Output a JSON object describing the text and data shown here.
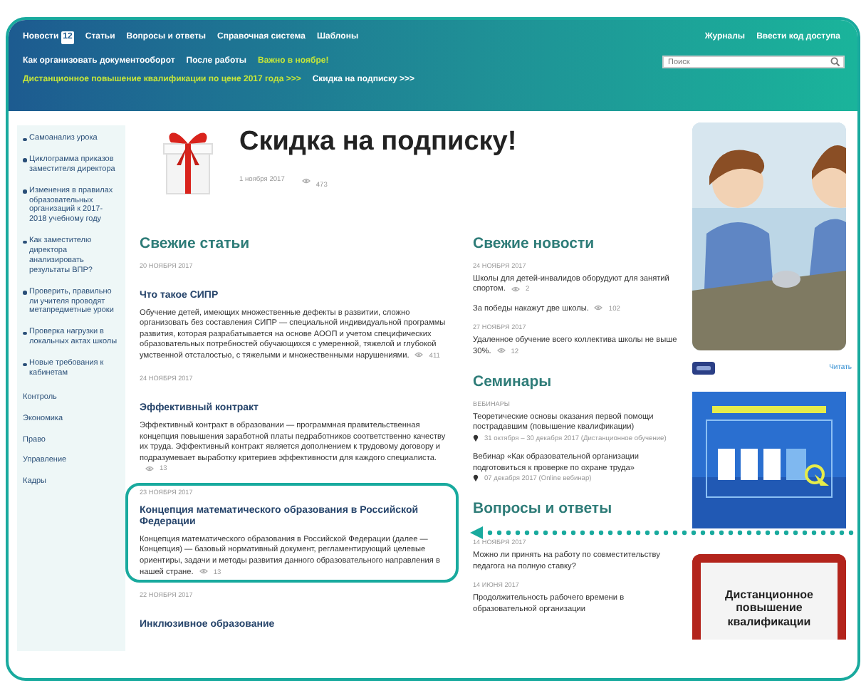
{
  "header": {
    "nav_primary": [
      {
        "label": "Новости",
        "badge": "12"
      },
      {
        "label": "Статьи"
      },
      {
        "label": "Вопросы и ответы"
      },
      {
        "label": "Справочная система"
      },
      {
        "label": "Шаблоны"
      }
    ],
    "nav_right": [
      "Журналы",
      "Ввести код доступа"
    ],
    "nav_secondary": [
      {
        "label": "Как организовать документооборот",
        "highlight": false
      },
      {
        "label": "После работы",
        "highlight": false
      },
      {
        "label": "Важно в ноябре!",
        "highlight": true
      }
    ],
    "search": {
      "placeholder": "Поиск"
    },
    "promos": [
      {
        "label": "Дистанционное повышение квалификации по цене 2017 года >>>",
        "highlight": true
      },
      {
        "label": "Скидка на подписку >>>",
        "highlight": false
      }
    ]
  },
  "sidebar": {
    "articles": [
      "Самоанализ урока",
      "Циклограмма приказов заместителя директора",
      "Изменения в правилах образовательных организаций к 2017-2018 учебному году",
      "Как заместителю директора анализировать результаты ВПР?",
      "Проверить, правильно ли учителя проводят метапредметные уроки",
      "Проверка нагрузки в локальных актах школы",
      "Новые требования к кабинетам"
    ],
    "categories": [
      "Контроль",
      "Экономика",
      "Право",
      "Управление",
      "Кадры"
    ]
  },
  "promo": {
    "title": "Скидка на подписку!",
    "date": "1 ноября 2017",
    "views": "473"
  },
  "articles": {
    "heading": "Свежие статьи",
    "items": [
      {
        "date": "20 НОЯБРЯ 2017",
        "title": "Что такое СИПР",
        "summary": "Обучение детей, имеющих множественные дефекты в развитии, сложно организовать без составления СИПР — специальной индивидуальной программы развития, которая разрабатывается на основе АООП и учетом специфических образовательных потребностей обучающихся с умеренной, тяжелой и глубокой умственной отсталостью, с тяжелыми и множественными нарушениями.",
        "views": "411",
        "highlighted": false
      },
      {
        "date": "24 НОЯБРЯ 2017",
        "title": "Эффективный контракт",
        "summary": "Эффективный контракт в образовании — программная правительственная концепция повышения заработной платы педработников соответственно качеству их труда. Эффективный контракт является дополнением к трудовому договору и подразумевает выработку критериев эффективности для каждого специалиста.",
        "views": "13",
        "highlighted": false
      },
      {
        "date": "23 НОЯБРЯ 2017",
        "title": "Концепция математического образования в Российской Федерации",
        "summary": "Концепция математического образования в Российской Федерации (далее — Концепция) — базовый нормативный документ, регламентирующий целевые ориентиры, задачи и методы развития данного образовательного направления в нашей стране.",
        "views": "13",
        "highlighted": true
      },
      {
        "date": "22 НОЯБРЯ 2017",
        "title": "Инклюзивное образование",
        "highlighted": false
      }
    ]
  },
  "news": {
    "heading": "Свежие новости",
    "items": [
      {
        "date": "24 НОЯБРЯ 2017",
        "text": "Школы для детей-инвалидов оборудуют для занятий спортом.",
        "views": "2"
      },
      {
        "text": "За победы накажут две школы.",
        "views": "102"
      },
      {
        "date": "27 НОЯБРЯ 2017",
        "text": "Удаленное обучение всего коллектива школы не выше 30%.",
        "views": "12"
      }
    ]
  },
  "seminars": {
    "heading": "Семинары",
    "items": [
      {
        "category": "ВЕБИНАРЫ",
        "title": "Теоретические основы оказания первой помощи пострадавшим (повышение квалификации)",
        "when": "31 октября – 30 декабря 2017 (Дистанционное обучение)"
      },
      {
        "title": "Вебинар «Как образовательной организации подготовиться к проверке по охране труда»",
        "when": "07 декабря 2017 (Online вебинар)"
      }
    ]
  },
  "qa": {
    "heading": "Вопросы и ответы",
    "items": [
      {
        "date": "14 НОЯБРЯ 2017",
        "text": "Можно ли принять на работу по совместительству педагога на полную ставку?"
      },
      {
        "date": "14 ИЮНЯ 2017",
        "text": "Продолжительность рабочего времени в образовательной организации"
      }
    ]
  },
  "aside": {
    "link": "Читать",
    "ad": "Дистанционное повышение квалификации"
  }
}
